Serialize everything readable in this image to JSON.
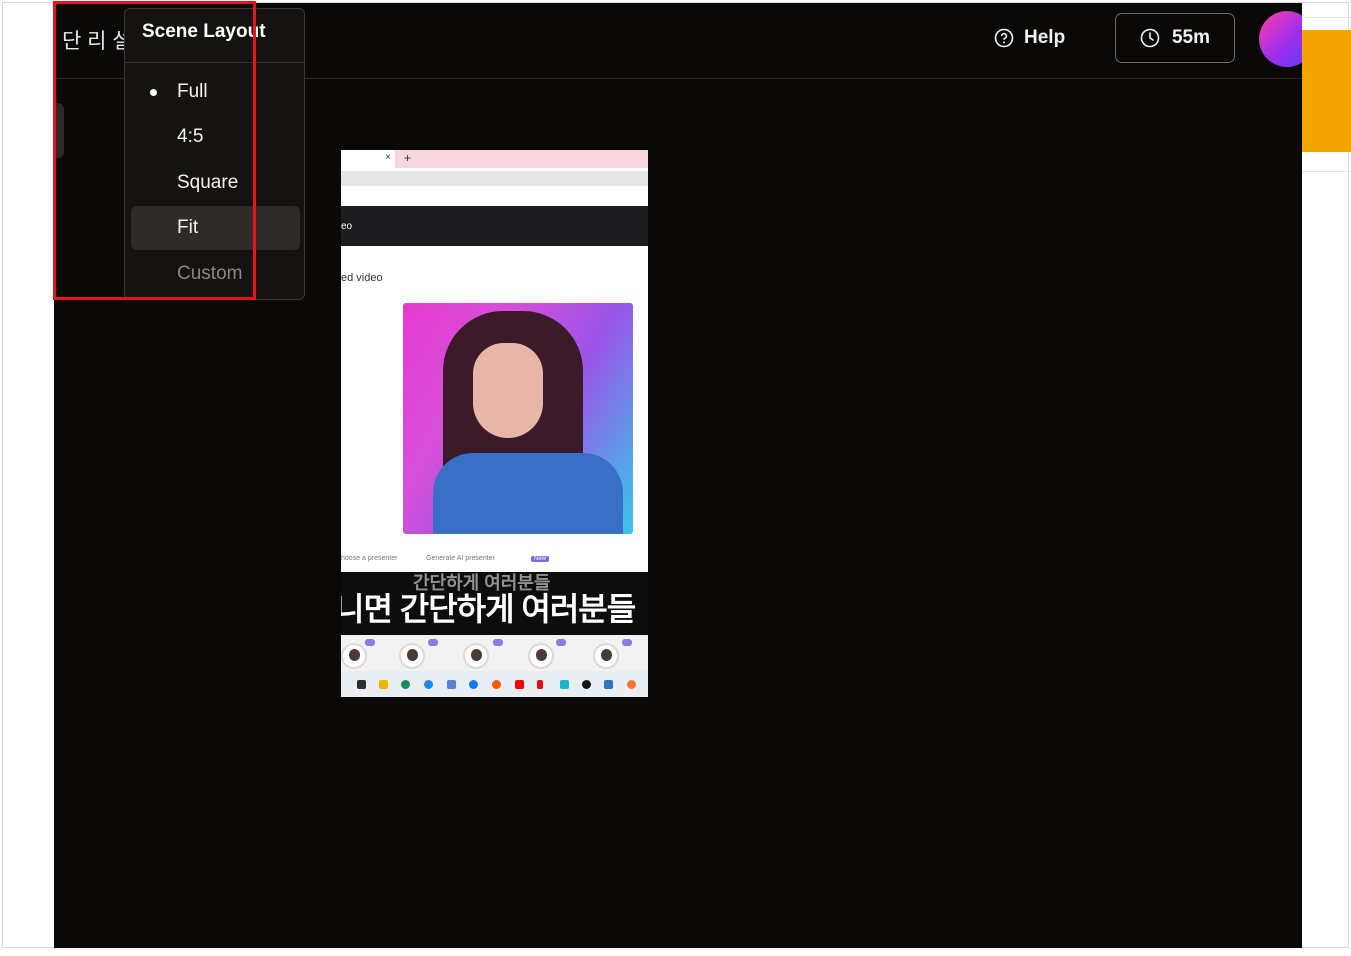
{
  "header": {
    "title": "단 리 설정",
    "help_label": "Help",
    "timer_label": "55m"
  },
  "scene_layout_menu": {
    "title": "Scene Layout",
    "options": [
      {
        "label": "Full",
        "selected": true
      },
      {
        "label": "4:5",
        "selected": false
      },
      {
        "label": "Square",
        "selected": false
      },
      {
        "label": "Fit",
        "selected": false,
        "hovered": true
      },
      {
        "label": "Custom",
        "selected": false,
        "disabled": true
      }
    ]
  },
  "preview": {
    "dark_band_text": "eo",
    "section_label": "ed video",
    "presenter_option": "hoose a presenter",
    "generate_option": "Generate AI presenter",
    "new_badge": "New",
    "subtitle_small": "간단하게 여러분들",
    "subtitle_large": "니면 간단하게 여러분들"
  },
  "colors": {
    "app_background": "#0b0908",
    "highlight_border": "#e5161b",
    "accent_orange": "#f5a300"
  }
}
